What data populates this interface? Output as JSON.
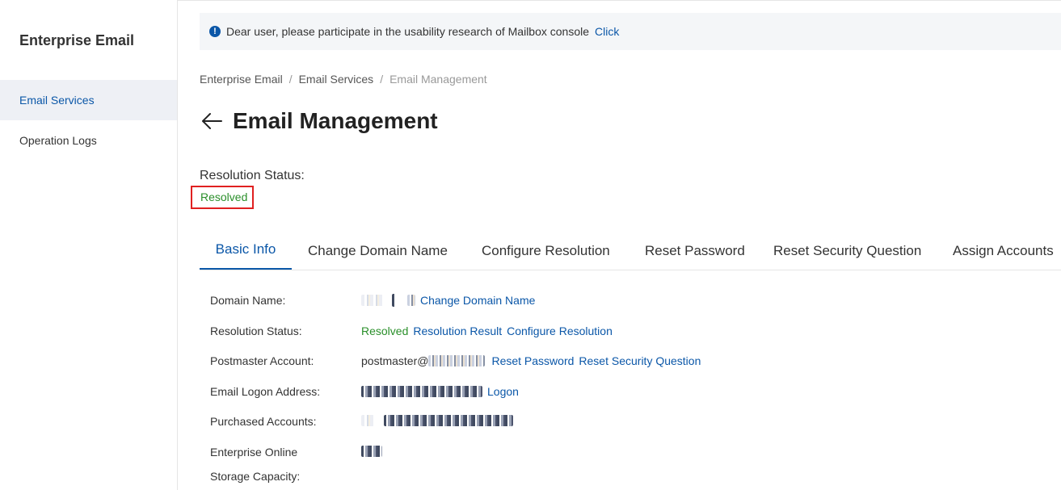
{
  "sidebar": {
    "title": "Enterprise Email",
    "items": [
      {
        "label": "Email Services",
        "active": true
      },
      {
        "label": "Operation Logs",
        "active": false
      }
    ]
  },
  "notice": {
    "icon": "info-icon",
    "text": "Dear user, please participate in the usability research of Mailbox console",
    "link": "Click"
  },
  "breadcrumb": [
    "Enterprise Email",
    "Email Services",
    "Email Management"
  ],
  "breadcrumb_separator": "/",
  "page_title": "Email Management",
  "resolution": {
    "label": "Resolution Status:",
    "value": "Resolved"
  },
  "tabs": [
    {
      "label": "Basic Info",
      "active": true
    },
    {
      "label": "Change Domain Name",
      "active": false
    },
    {
      "label": "Configure Resolution",
      "active": false
    },
    {
      "label": "Reset Password",
      "active": false
    },
    {
      "label": "Reset Security Question",
      "active": false
    },
    {
      "label": "Assign Accounts",
      "active": false
    }
  ],
  "info": {
    "domain_name": {
      "label": "Domain Name:",
      "link": "Change Domain Name"
    },
    "resolution_status": {
      "label": "Resolution Status:",
      "value": "Resolved",
      "links": [
        "Resolution Result",
        "Configure Resolution"
      ]
    },
    "postmaster_account": {
      "label": "Postmaster Account:",
      "value_prefix": "postmaster@",
      "links": [
        "Reset Password",
        "Reset Security Question"
      ]
    },
    "email_logon_address": {
      "label": "Email Logon Address:",
      "link": "Logon"
    },
    "purchased_accounts": {
      "label": "Purchased Accounts:"
    },
    "enterprise_online": {
      "label_line1": "Enterprise Online",
      "label_line2": "Storage Capacity:"
    }
  },
  "colors": {
    "accent": "#ff6a00",
    "link": "#0b57a8",
    "success": "#2a8f2a",
    "highlight_box": "#e02020"
  }
}
